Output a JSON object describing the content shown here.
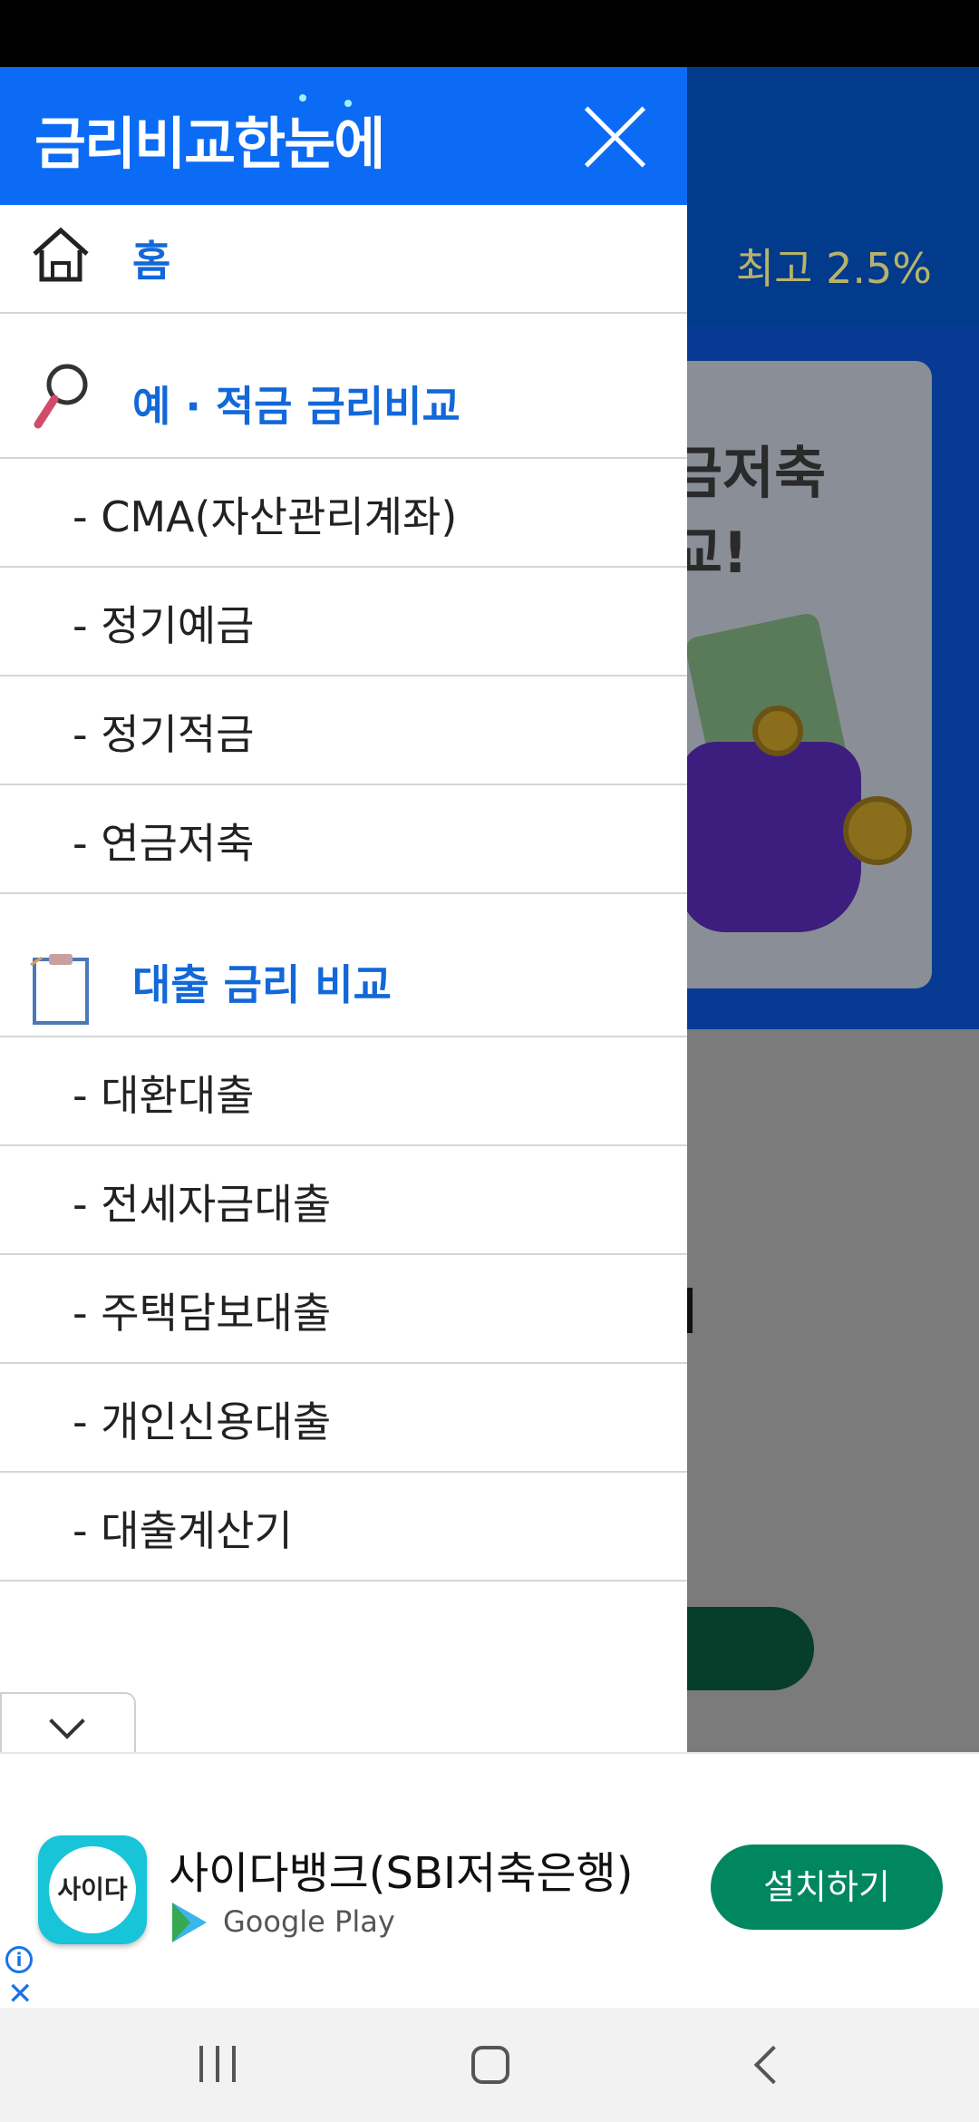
{
  "background": {
    "rate_text": "최고 2.5%",
    "hero_text": "금저축\n교!"
  },
  "drawer": {
    "logo": "금리비교한눈에",
    "home_label": "홈",
    "savings_section": {
      "title": "예 · 적금 금리비교",
      "items": [
        "- CMA(자산관리계좌)",
        "- 정기예금",
        "- 정기적금",
        "- 연금저축"
      ]
    },
    "loan_section": {
      "title": "대출 금리 비교",
      "items": [
        "- 대환대출",
        "- 전세자금대출",
        "- 주택담보대출",
        "- 개인신용대출",
        "- 대출계산기"
      ]
    }
  },
  "ad": {
    "app_icon_text": "사이다",
    "title": "사이다뱅크(SBI저축은행)",
    "store": "Google Play",
    "install_label": "설치하기",
    "info_glyph": "i",
    "close_glyph": "✕"
  },
  "colors": {
    "drawer_header": "#0b6bf5",
    "section_title": "#1268d8",
    "install_button": "#01875f"
  }
}
